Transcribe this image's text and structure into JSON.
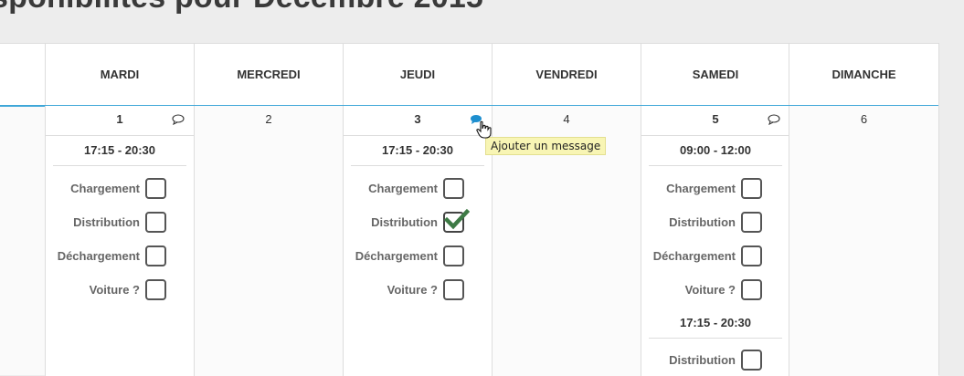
{
  "page": {
    "title": "sponibilités pour Décembre 2015"
  },
  "calendar": {
    "days": [
      {
        "name": "MARDI",
        "number": "1",
        "message_icon": "speech-bubble-outline-icon",
        "slots": [
          {
            "time": "17:15 - 20:30",
            "tasks": [
              {
                "label": "Chargement",
                "checked": false
              },
              {
                "label": "Distribution",
                "checked": false
              },
              {
                "label": "Déchargement",
                "checked": false
              },
              {
                "label": "Voiture ?",
                "checked": false
              }
            ]
          }
        ]
      },
      {
        "name": "MERCREDI",
        "number": "2",
        "slots": []
      },
      {
        "name": "JEUDI",
        "number": "3",
        "message_icon": "speech-bubble-filled-icon",
        "slots": [
          {
            "time": "17:15 - 20:30",
            "tasks": [
              {
                "label": "Chargement",
                "checked": false
              },
              {
                "label": "Distribution",
                "checked": true
              },
              {
                "label": "Déchargement",
                "checked": false
              },
              {
                "label": "Voiture ?",
                "checked": false
              }
            ]
          }
        ]
      },
      {
        "name": "VENDREDI",
        "number": "4",
        "slots": []
      },
      {
        "name": "SAMEDI",
        "number": "5",
        "message_icon": "speech-bubble-outline-icon",
        "slots": [
          {
            "time": "09:00 - 12:00",
            "tasks": [
              {
                "label": "Chargement",
                "checked": false
              },
              {
                "label": "Distribution",
                "checked": false
              },
              {
                "label": "Déchargement",
                "checked": false
              },
              {
                "label": "Voiture ?",
                "checked": false
              }
            ]
          },
          {
            "time": "17:15 - 20:30",
            "tasks": [
              {
                "label": "Distribution",
                "checked": false
              }
            ]
          }
        ]
      },
      {
        "name": "DIMANCHE",
        "number": "6",
        "slots": []
      }
    ]
  },
  "tooltip": {
    "text": "Ajouter un message"
  },
  "colors": {
    "accent": "#3fa7d8",
    "check": "#3d7a45",
    "tooltip_bg": "#f8f5b4"
  }
}
